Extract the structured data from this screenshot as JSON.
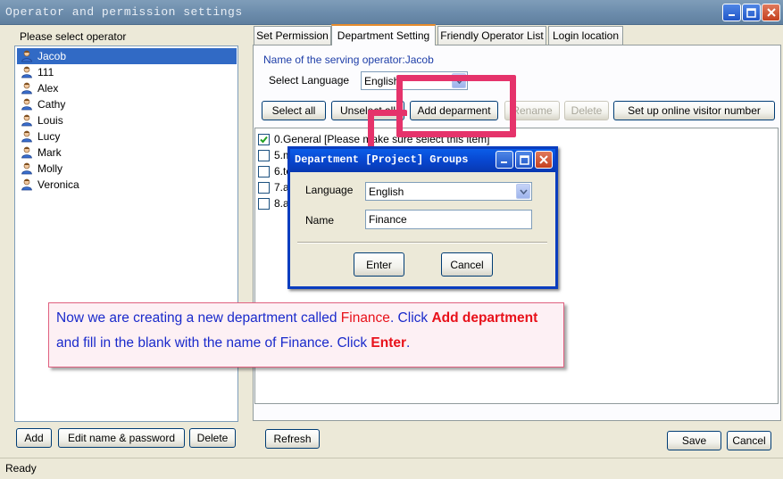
{
  "window": {
    "title": "Operator and permission settings"
  },
  "left": {
    "heading": "Please select operator",
    "operators": [
      {
        "name": "Jacob",
        "selected": true
      },
      {
        "name": "111"
      },
      {
        "name": "Alex"
      },
      {
        "name": "Cathy"
      },
      {
        "name": "Louis"
      },
      {
        "name": "Lucy"
      },
      {
        "name": "Mark"
      },
      {
        "name": "Molly"
      },
      {
        "name": "Veronica"
      }
    ],
    "add_label": "Add",
    "edit_label": "Edit name & password",
    "delete_label": "Delete"
  },
  "tabs": [
    {
      "label": "Set Permission"
    },
    {
      "label": "Department Setting",
      "active": true
    },
    {
      "label": "Friendly Operator List"
    },
    {
      "label": "Login location"
    }
  ],
  "dept": {
    "operator_text": "Name of the serving operator:Jacob",
    "language_label": "Select Language",
    "language_value": "English",
    "select_all": "Select all",
    "unselect_all": "Unselect all",
    "add_department": "Add deparment",
    "rename": "Rename",
    "delete": "Delete",
    "online_visitor": "Set up online visitor number",
    "items": [
      {
        "label": "0.General [Please make sure select this item]",
        "checked": true
      },
      {
        "label": "5.m",
        "checked": false
      },
      {
        "label": "6.te",
        "checked": false
      },
      {
        "label": "7.a",
        "checked": false
      },
      {
        "label": "8.a",
        "checked": false
      }
    ],
    "refresh": "Refresh",
    "save": "Save",
    "cancel": "Cancel"
  },
  "dialog": {
    "title": "Department [Project] Groups",
    "language_label": "Language",
    "language_value": "English",
    "name_label": "Name",
    "name_value": "Finance",
    "enter": "Enter",
    "cancel": "Cancel"
  },
  "callout": {
    "part1": "Now we are creating a new department called ",
    "part2": "Finance",
    "part3": ". Click ",
    "part4": "Add department",
    "part5": "and fill in the blank with the name of Finance. Click ",
    "part6": "Enter",
    "part7": "."
  },
  "status": {
    "text": "Ready"
  },
  "colors": {
    "accent": "#316ac5",
    "highlight": "#e5336b",
    "callout_text": "#1a2acb",
    "callout_emphasis": "#e8111a"
  }
}
